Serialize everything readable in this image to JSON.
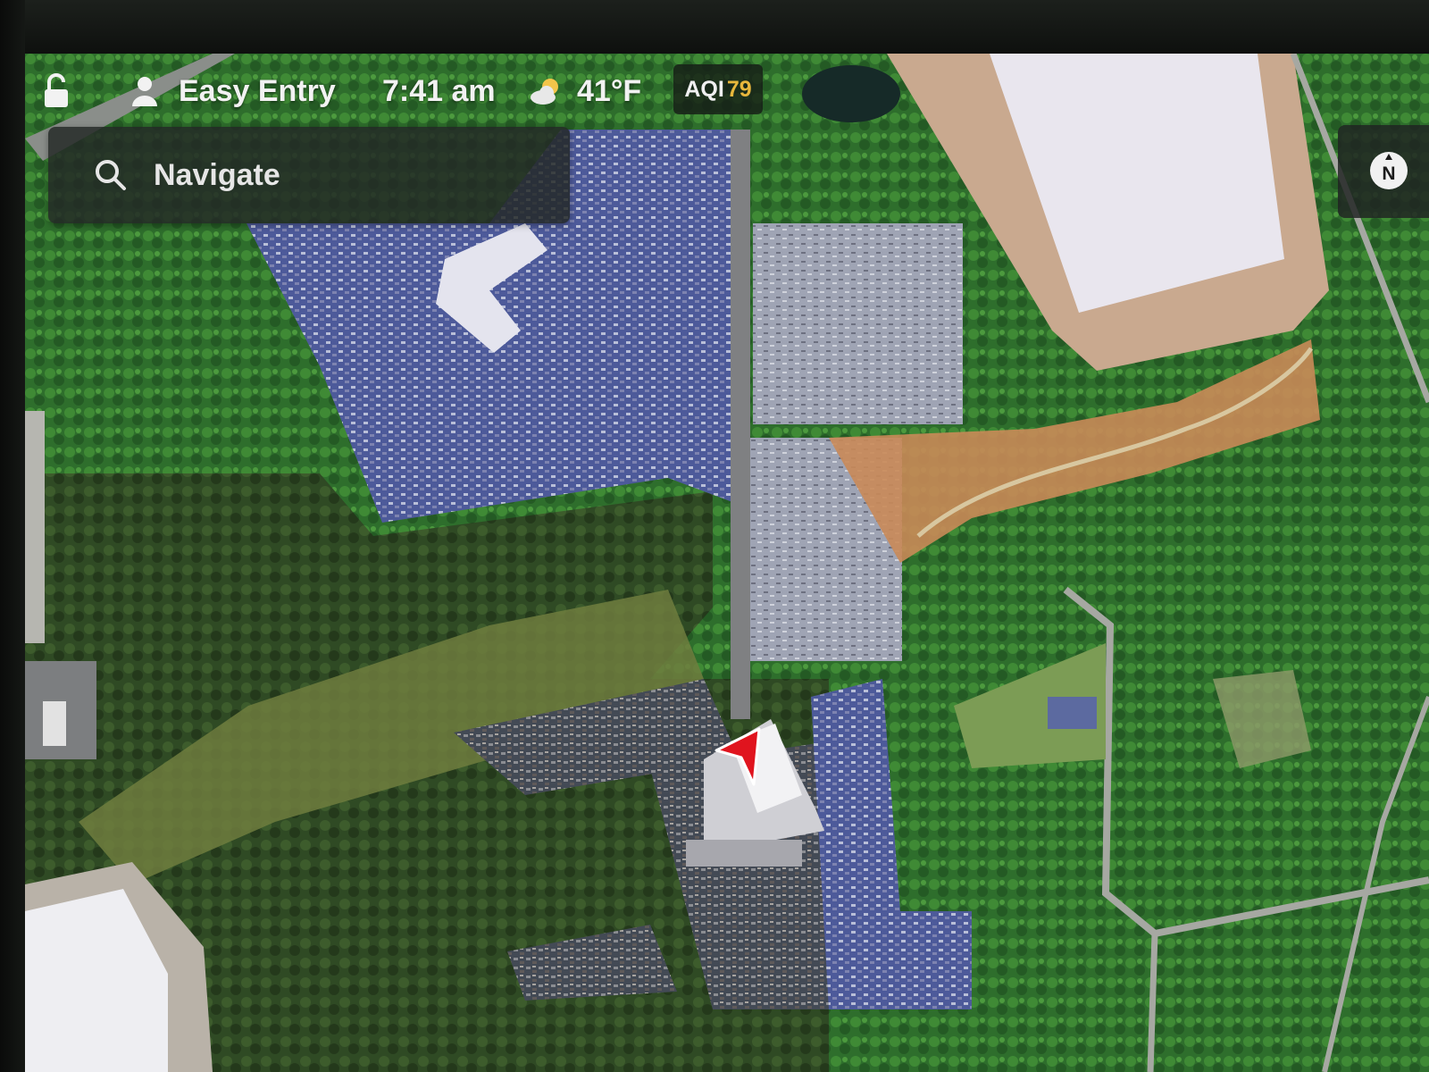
{
  "status_bar": {
    "lock_icon": "unlocked-padlock-icon",
    "profile_icon": "person-icon",
    "profile_name": "Easy Entry",
    "time": "7:41 am",
    "weather_icon": "partly-cloudy-icon",
    "temperature": "41°F",
    "aqi_label": "AQI",
    "aqi_value": "79"
  },
  "search": {
    "icon": "search-icon",
    "placeholder": "Navigate"
  },
  "compass": {
    "icon": "compass-icon",
    "heading_letter": "N"
  },
  "map": {
    "style": "satellite",
    "car_marker_icon": "navigation-arrow-icon",
    "car_marker_color": "#e0141e"
  },
  "colors": {
    "aqi_value": "#e8b73c",
    "panel_background": "#242826"
  }
}
